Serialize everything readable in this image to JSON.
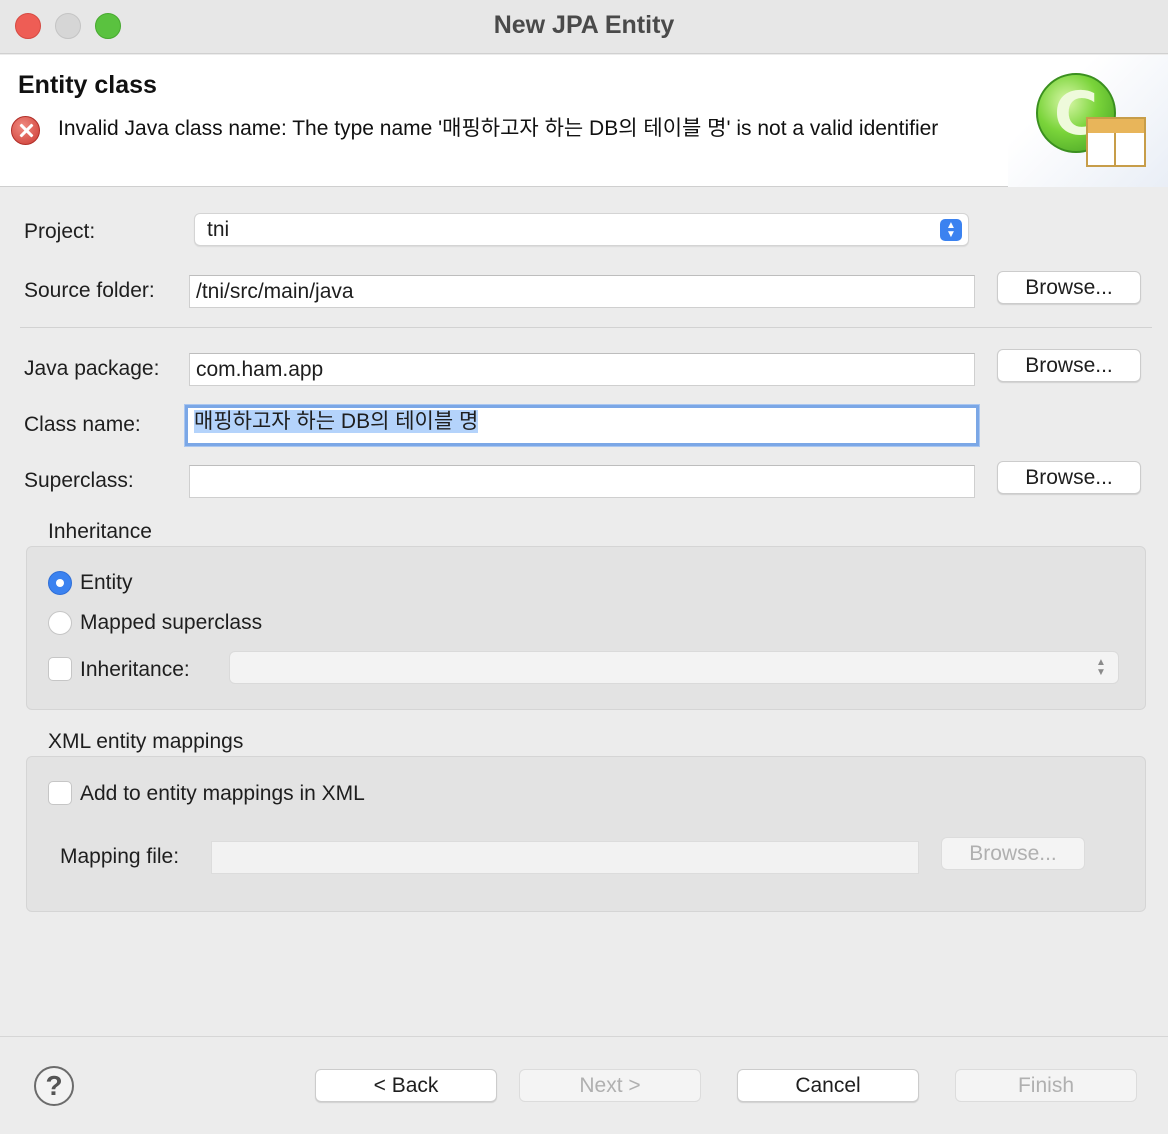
{
  "window": {
    "title": "New JPA Entity"
  },
  "header": {
    "title": "Entity class",
    "error_message": "Invalid Java class name: The type name '매핑하고자 하는 DB의 테이블 명' is not a valid identifier"
  },
  "form": {
    "project_label": "Project:",
    "project_value": "tni",
    "source_folder_label": "Source folder:",
    "source_folder_value": "/tni/src/main/java",
    "java_package_label": "Java package:",
    "java_package_value": "com.ham.app",
    "class_name_label": "Class name:",
    "class_name_value": "매핑하고자 하는 DB의 테이블 명",
    "superclass_label": "Superclass:",
    "superclass_value": "",
    "browse_label": "Browse..."
  },
  "inheritance": {
    "group_title": "Inheritance",
    "entity_label": "Entity",
    "mapped_superclass_label": "Mapped superclass",
    "inheritance_label": "Inheritance:",
    "selected": "Entity"
  },
  "xml": {
    "group_title": "XML entity mappings",
    "add_label": "Add to entity mappings in XML",
    "mapping_file_label": "Mapping file:",
    "browse_label": "Browse..."
  },
  "footer": {
    "help_symbol": "?",
    "back_label": "< Back",
    "next_label": "Next >",
    "cancel_label": "Cancel",
    "finish_label": "Finish"
  },
  "colors": {
    "accent": "#3b82f0",
    "error": "#cc3a33",
    "focus_ring": "#7ba7e6"
  }
}
